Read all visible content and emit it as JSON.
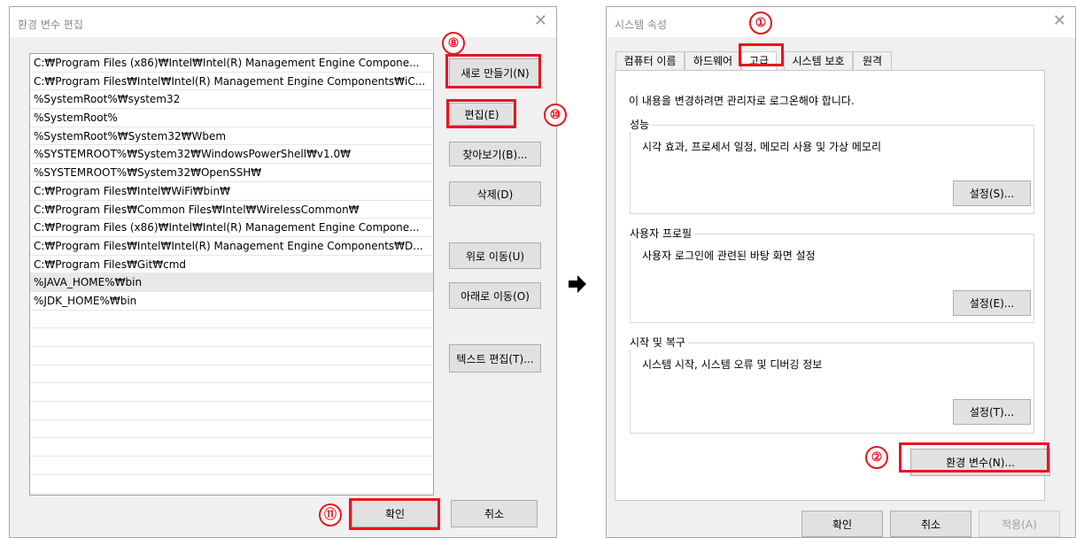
{
  "left_dialog": {
    "title": "환경 변수 편집",
    "close_icon": "close-icon",
    "paths": [
      "C:₩Program Files (x86)₩Intel₩Intel(R) Management Engine Compone...",
      "C:₩Program Files₩Intel₩Intel(R) Management Engine Components₩iC...",
      "%SystemRoot%₩system32",
      "%SystemRoot%",
      "%SystemRoot%₩System32₩Wbem",
      "%SYSTEMROOT%₩System32₩WindowsPowerShell₩v1.0₩",
      "%SYSTEMROOT%₩System32₩OpenSSH₩",
      "C:₩Program Files₩Intel₩WiFi₩bin₩",
      "C:₩Program Files₩Common Files₩Intel₩WirelessCommon₩",
      "C:₩Program Files (x86)₩Intel₩Intel(R) Management Engine Compone...",
      "C:₩Program Files₩Intel₩Intel(R) Management Engine Components₩D...",
      "C:₩Program Files₩Git₩cmd",
      "%JAVA_HOME%₩bin",
      "%JDK_HOME%₩bin"
    ],
    "selected_index": 12,
    "buttons": {
      "new": "새로 만들기(N)",
      "edit": "편집(E)",
      "browse": "찾아보기(B)...",
      "delete": "삭제(D)",
      "move_up": "위로 이동(U)",
      "move_down": "아래로 이동(O)",
      "edit_text": "텍스트 편집(T)...",
      "ok": "확인",
      "cancel": "취소"
    }
  },
  "right_dialog": {
    "title": "시스템 속성",
    "close_icon": "close-icon",
    "tabs": [
      "컴퓨터 이름",
      "하드웨어",
      "고급",
      "시스템 보호",
      "원격"
    ],
    "active_tab": "고급",
    "admin_note": "이 내용을 변경하려면 관리자로 로그온해야 합니다.",
    "groups": {
      "performance": {
        "title": "성능",
        "desc": "시각 효과, 프로세서 일정, 메모리 사용 및 가상 메모리",
        "button": "설정(S)..."
      },
      "profile": {
        "title": "사용자 프로필",
        "desc": "사용자 로그인에 관련된 바탕 화면 설정",
        "button": "설정(E)..."
      },
      "startup": {
        "title": "시작 및 복구",
        "desc": "시스템 시작, 시스템 오류 및 디버깅 정보",
        "button": "설정(T)..."
      }
    },
    "env_button": "환경 변수(N)...",
    "ok": "확인",
    "cancel": "취소",
    "apply": "적용(A)"
  },
  "annotations": {
    "step1": "①",
    "step2": "②",
    "step8": "⑧",
    "step10": "⑩",
    "step11": "⑪",
    "highlight_color": "#e8151f"
  },
  "arrow_icon": "right-arrow-icon"
}
